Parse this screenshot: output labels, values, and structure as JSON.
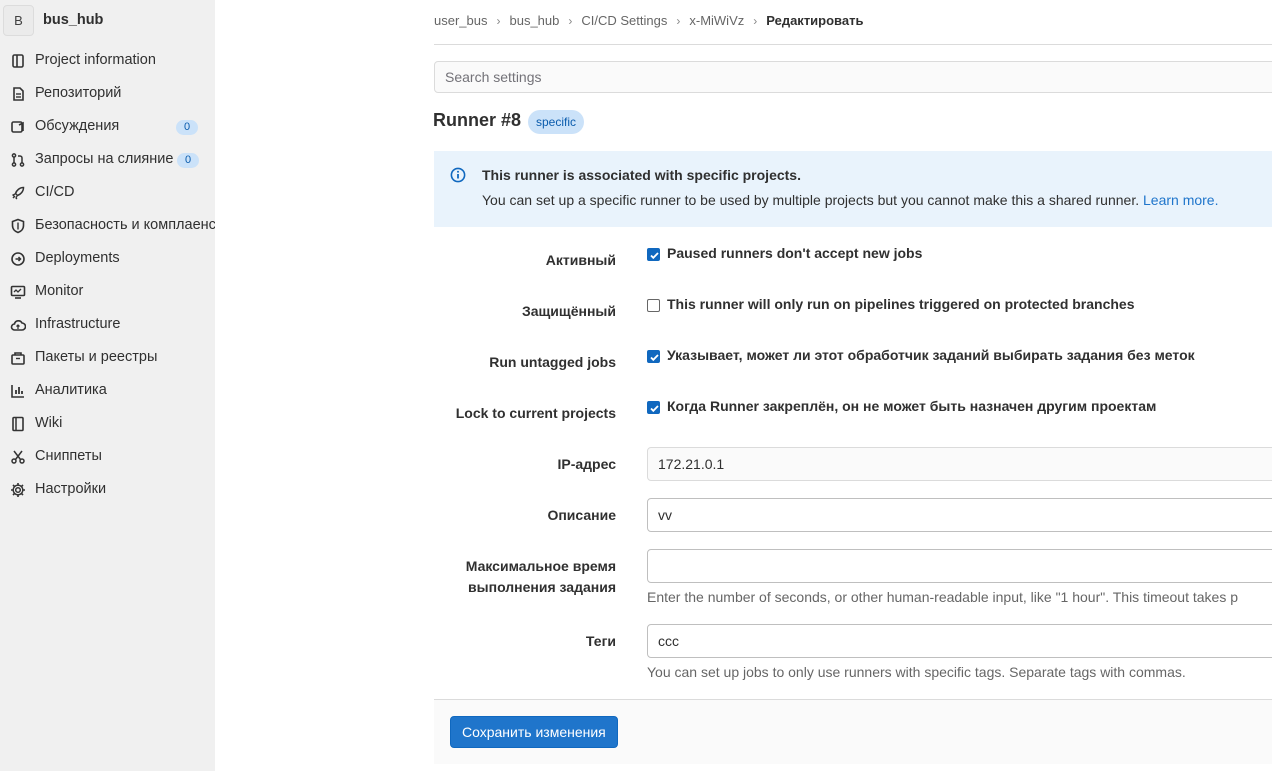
{
  "project": {
    "avatar_letter": "B",
    "name": "bus_hub"
  },
  "sidebar": {
    "items": [
      {
        "label": "Project information",
        "icon": "project-info-icon"
      },
      {
        "label": "Репозиторий",
        "icon": "document-icon"
      },
      {
        "label": "Обсуждения",
        "icon": "issues-icon",
        "badge": "0"
      },
      {
        "label": "Запросы на слияние",
        "icon": "merge-request-icon",
        "badge": "0"
      },
      {
        "label": "CI/CD",
        "icon": "rocket-icon"
      },
      {
        "label": "Безопасность и комплаенс",
        "icon": "shield-icon"
      },
      {
        "label": "Deployments",
        "icon": "deployments-icon"
      },
      {
        "label": "Monitor",
        "icon": "monitor-icon"
      },
      {
        "label": "Infrastructure",
        "icon": "cloud-icon"
      },
      {
        "label": "Пакеты и реестры",
        "icon": "package-icon"
      },
      {
        "label": "Аналитика",
        "icon": "chart-icon"
      },
      {
        "label": "Wiki",
        "icon": "book-icon"
      },
      {
        "label": "Сниппеты",
        "icon": "scissors-icon"
      },
      {
        "label": "Настройки",
        "icon": "gear-icon"
      }
    ]
  },
  "breadcrumb": {
    "items": [
      "user_bus",
      "bus_hub",
      "CI/CD Settings",
      "x-MiWiVz"
    ],
    "current": "Редактировать"
  },
  "search": {
    "placeholder": "Search settings",
    "value": ""
  },
  "runner": {
    "title": "Runner #8",
    "badge": "specific"
  },
  "alert": {
    "title": "This runner is associated with specific projects.",
    "body": "You can set up a specific runner to be used by multiple projects but you cannot make this a shared runner.",
    "link": "Learn more."
  },
  "form": {
    "active": {
      "label": "Активный",
      "text": "Paused runners don't accept new jobs",
      "checked": true
    },
    "protected": {
      "label": "Защищённый",
      "text": "This runner will only run on pipelines triggered on protected branches",
      "checked": false
    },
    "untagged": {
      "label": "Run untagged jobs",
      "text": "Указывает, может ли этот обработчик заданий выбирать задания без меток",
      "checked": true
    },
    "locked": {
      "label": "Lock to current projects",
      "text": "Когда Runner закреплён, он не может быть назначен другим проектам",
      "checked": true
    },
    "ip": {
      "label": "IP-адрес",
      "value": "172.21.0.1"
    },
    "description": {
      "label": "Описание",
      "value": "vv"
    },
    "timeout": {
      "label_line1": "Максимальное время",
      "label_line2": "выполнения задания",
      "value": "",
      "help": "Enter the number of seconds, or other human-readable input, like \"1 hour\". This timeout takes p"
    },
    "tags": {
      "label": "Теги",
      "value": "ccc",
      "help": "You can set up jobs to only use runners with specific tags. Separate tags with commas."
    }
  },
  "save_button": "Сохранить изменения",
  "colors": {
    "accent": "#1f75cb",
    "badge_bg": "#cbe2f9",
    "alert_bg": "#e9f3fc",
    "sidebar_bg": "#f0f0f0"
  }
}
